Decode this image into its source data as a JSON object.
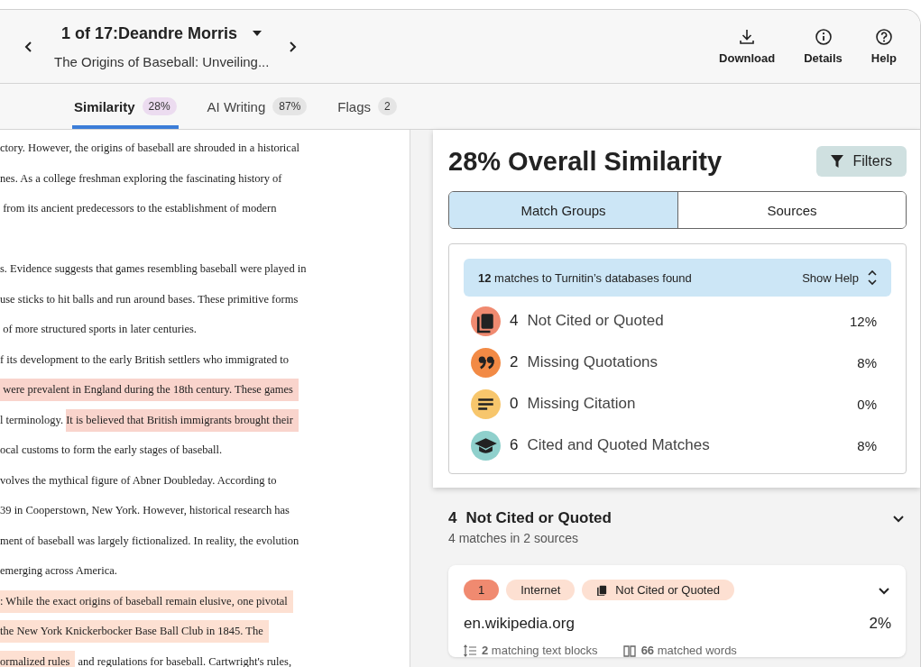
{
  "header": {
    "counter": "1 of 17:Deandre Morris",
    "subtitle": "The Origins of Baseball: Unveiling...",
    "actions": [
      {
        "kind": "download",
        "label": "Download"
      },
      {
        "kind": "details",
        "label": "Details"
      },
      {
        "kind": "help",
        "label": "Help"
      }
    ]
  },
  "tabs": [
    {
      "label": "Similarity",
      "badge": "28%",
      "selected": true
    },
    {
      "label": "AI Writing",
      "badge": "87%",
      "selected": false
    },
    {
      "label": "Flags",
      "badge": "2",
      "selected": false
    }
  ],
  "document": {
    "lines": [
      {
        "kind": "text",
        "segments": [
          {
            "text": "ctory. However, the origins of baseball are shrouded in a historical",
            "kind": "plain"
          }
        ]
      },
      {
        "kind": "text",
        "segments": [
          {
            "text": "nes. As a college freshman exploring the fascinating history of",
            "kind": "plain"
          }
        ]
      },
      {
        "kind": "text",
        "segments": [
          {
            "text": " from its ancient predecessors to the establishment of modern",
            "kind": "plain"
          }
        ]
      },
      {
        "kind": "blank"
      },
      {
        "kind": "text",
        "segments": [
          {
            "text": "s. Evidence suggests that games resembling baseball were played in",
            "kind": "plain"
          }
        ]
      },
      {
        "kind": "text",
        "segments": [
          {
            "text": "use sticks to hit balls and run around bases. These primitive forms",
            "kind": "plain"
          }
        ]
      },
      {
        "kind": "text",
        "segments": [
          {
            "text": " of more structured sports in later centuries.",
            "kind": "plain"
          }
        ]
      },
      {
        "kind": "text",
        "segments": [
          {
            "text": "f its development to the early British settlers who immigrated to",
            "kind": "plain"
          }
        ]
      },
      {
        "kind": "text",
        "segments": [
          {
            "text": " were prevalent in England during the 18th century. These games",
            "kind": "not_cited"
          }
        ]
      },
      {
        "kind": "text",
        "segments": [
          {
            "text": "l terminology. ",
            "kind": "plain"
          },
          {
            "text": "It is believed that British immigrants brought their",
            "kind": "not_cited"
          }
        ]
      },
      {
        "kind": "text",
        "segments": [
          {
            "text": "ocal customs to form the early stages of baseball.",
            "kind": "plain"
          }
        ]
      },
      {
        "kind": "text",
        "segments": [
          {
            "text": "volves the mythical figure of Abner Doubleday. According to",
            "kind": "plain"
          }
        ]
      },
      {
        "kind": "text",
        "segments": [
          {
            "text": "39 in Cooperstown, New York. However, historical research has",
            "kind": "plain"
          }
        ]
      },
      {
        "kind": "text",
        "segments": [
          {
            "text": "ment of baseball was largely fictionalized. In reality, the evolution",
            "kind": "plain"
          }
        ]
      },
      {
        "kind": "text",
        "segments": [
          {
            "text": "emerging across America.",
            "kind": "plain"
          }
        ]
      },
      {
        "kind": "text",
        "segments": [
          {
            "text": ": While the exact origins of baseball remain elusive, one pivotal",
            "kind": "missing_quotation"
          }
        ]
      },
      {
        "kind": "text",
        "segments": [
          {
            "text": "the New York Knickerbocker Base Ball Club in 1845. The",
            "kind": "missing_quotation"
          }
        ]
      },
      {
        "kind": "text",
        "segments": [
          {
            "text": "ormalized rules",
            "kind": "missing_quotation"
          },
          {
            "text": " and regulations for baseball. Cartwright's rules,",
            "kind": "plain"
          }
        ]
      }
    ]
  },
  "panel": {
    "title": "28% Overall Similarity",
    "filters": "Filters",
    "views": [
      {
        "label": "Match Groups",
        "selected": true
      },
      {
        "label": "Sources",
        "selected": false
      }
    ],
    "summary": "**12** matches to Turnitin’s databases found",
    "show_help": "Show Help",
    "categories": [
      {
        "kind": "copy",
        "color": "#f08a70",
        "count": "4",
        "label": "Not Cited or Quoted",
        "percent": "12%"
      },
      {
        "kind": "quote",
        "color": "#f28a45",
        "count": "2",
        "label": "Missing Quotations",
        "percent": "8%"
      },
      {
        "kind": "lines",
        "color": "#f7c66c",
        "count": "0",
        "label": "Missing Citation",
        "percent": "0%"
      },
      {
        "kind": "cap",
        "color": "#8fd0cc",
        "count": "6",
        "label": "Cited and Quoted Matches",
        "percent": "8%"
      }
    ]
  },
  "group": {
    "count": "4",
    "title": "Not Cited or Quoted",
    "subtitle": "4 matches in 2 sources",
    "source": {
      "number": "1",
      "type": "Internet",
      "category": "Not Cited or Quoted",
      "name": "en.wikipedia.org",
      "percent": "2%",
      "blocks": "**2** matching text blocks",
      "words": "**66** matched words"
    }
  }
}
